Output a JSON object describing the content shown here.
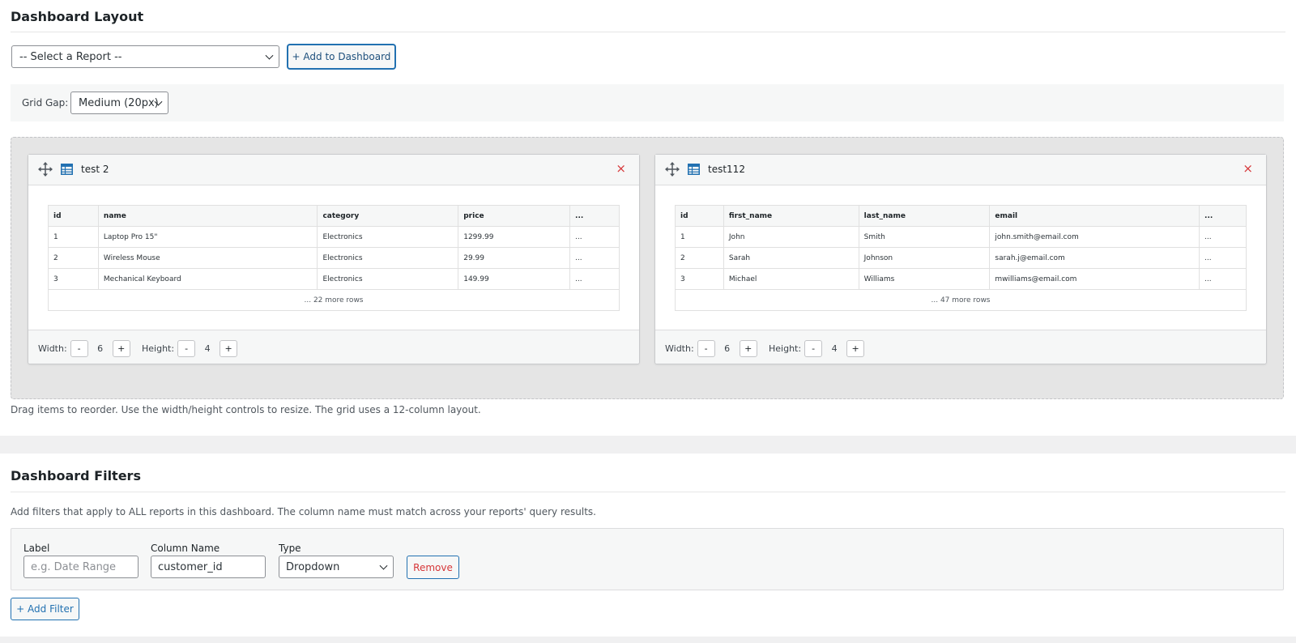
{
  "layout": {
    "title": "Dashboard Layout",
    "report_select": "-- Select a Report --",
    "add_button": "+ Add to Dashboard",
    "grid_gap_label": "Grid Gap:",
    "grid_gap_value": "Medium (20px)",
    "help_text": "Drag items to reorder. Use the width/height controls to resize. The grid uses a 12-column layout."
  },
  "cards": [
    {
      "title": "test 2",
      "columns": [
        "id",
        "name",
        "category",
        "price",
        "..."
      ],
      "rows": [
        [
          "1",
          "Laptop Pro 15\"",
          "Electronics",
          "1299.99",
          "..."
        ],
        [
          "2",
          "Wireless Mouse",
          "Electronics",
          "29.99",
          "..."
        ],
        [
          "3",
          "Mechanical Keyboard",
          "Electronics",
          "149.99",
          "..."
        ]
      ],
      "more_rows": "... 22 more rows",
      "width_label": "Width:",
      "width": "6",
      "height_label": "Height:",
      "height": "4"
    },
    {
      "title": "test112",
      "columns": [
        "id",
        "first_name",
        "last_name",
        "email",
        "..."
      ],
      "rows": [
        [
          "1",
          "John",
          "Smith",
          "john.smith@email.com",
          "..."
        ],
        [
          "2",
          "Sarah",
          "Johnson",
          "sarah.j@email.com",
          "..."
        ],
        [
          "3",
          "Michael",
          "Williams",
          "mwilliams@email.com",
          "..."
        ]
      ],
      "more_rows": "... 47 more rows",
      "width_label": "Width:",
      "width": "6",
      "height_label": "Height:",
      "height": "4"
    }
  ],
  "controls": {
    "minus": "-",
    "plus": "+",
    "close": "×"
  },
  "filters": {
    "title": "Dashboard Filters",
    "description": "Add filters that apply to ALL reports in this dashboard. The column name must match across your reports' query results.",
    "label_heading": "Label",
    "label_placeholder": "e.g. Date Range",
    "column_heading": "Column Name",
    "column_value": "customer_id",
    "type_heading": "Type",
    "type_value": "Dropdown",
    "remove_button": "Remove",
    "add_button": "+ Add Filter"
  },
  "colors": {
    "accent": "#2271b1",
    "danger": "#d63638"
  }
}
